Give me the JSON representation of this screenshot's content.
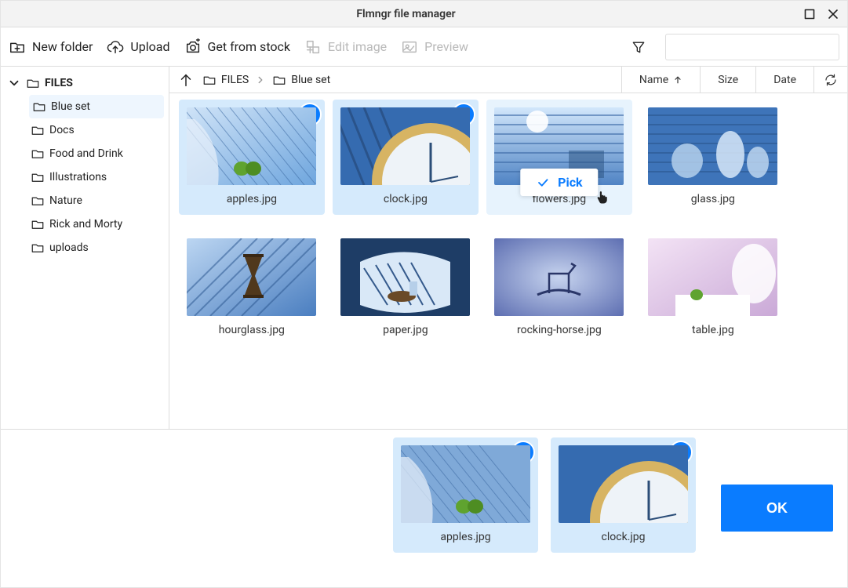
{
  "window": {
    "title": "Flmngr file manager"
  },
  "toolbar": {
    "new_folder": "New folder",
    "upload": "Upload",
    "get_from_stock": "Get from stock",
    "edit_image": "Edit image",
    "preview": "Preview",
    "search_value": ""
  },
  "sidebar": {
    "root": {
      "label": "FILES",
      "expanded": true
    },
    "children": [
      {
        "label": "Blue set",
        "selected": true
      },
      {
        "label": "Docs"
      },
      {
        "label": "Food and Drink"
      },
      {
        "label": "Illustrations"
      },
      {
        "label": "Nature"
      },
      {
        "label": "Rick and Morty"
      },
      {
        "label": "uploads"
      }
    ]
  },
  "breadcrumb": {
    "items": [
      {
        "label": "FILES"
      },
      {
        "label": "Blue set"
      }
    ]
  },
  "sort": {
    "columns": [
      "Name",
      "Size",
      "Date"
    ],
    "active": "Name",
    "direction": "asc"
  },
  "files": [
    {
      "name": "apples.jpg",
      "selected": true,
      "hovered": false
    },
    {
      "name": "clock.jpg",
      "selected": true,
      "hovered": false
    },
    {
      "name": "flowers.jpg",
      "selected": false,
      "hovered": true
    },
    {
      "name": "glass.jpg",
      "selected": false,
      "hovered": false
    },
    {
      "name": "hourglass.jpg",
      "selected": false,
      "hovered": false
    },
    {
      "name": "paper.jpg",
      "selected": false,
      "hovered": false
    },
    {
      "name": "rocking-horse.jpg",
      "selected": false,
      "hovered": false
    },
    {
      "name": "table.jpg",
      "selected": false,
      "hovered": false
    }
  ],
  "pick": {
    "label": "Pick"
  },
  "selected_tray": [
    {
      "name": "apples.jpg"
    },
    {
      "name": "clock.jpg"
    }
  ],
  "footer": {
    "ok": "OK"
  }
}
